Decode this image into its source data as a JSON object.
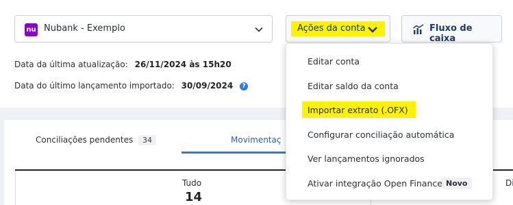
{
  "account_select": {
    "icon": "nu",
    "label": "Nubank - Exemplo"
  },
  "actions_button": {
    "label": "Ações da conta"
  },
  "cashflow_button": {
    "label": "Fluxo de caixa"
  },
  "info": {
    "last_update_label": "Data da última atualização:",
    "last_update_value": "26/11/2024 às 15h20",
    "last_import_label": "Data do último lançamento importado:",
    "last_import_value": "30/09/2024"
  },
  "tabs": {
    "pending_label": "Conciliações pendentes",
    "pending_count": "34",
    "moves_label": "Movimentaç"
  },
  "stats": {
    "all_label": "Tudo",
    "all_value": "14",
    "cut_label": "Di"
  },
  "menu": {
    "items": [
      {
        "label": "Editar conta"
      },
      {
        "label": "Editar saldo da conta"
      },
      {
        "label": "Importar extrato (.OFX)"
      },
      {
        "label": "Configurar conciliação automática"
      },
      {
        "label": "Ver lançamentos ignorados"
      },
      {
        "label": "Ativar integração Open Finance",
        "badge": "Novo"
      }
    ]
  },
  "colors": {
    "brand": "#8a05be",
    "highlight": "#fff200",
    "accent": "#2c7be5",
    "link": "#1b3a6b"
  }
}
